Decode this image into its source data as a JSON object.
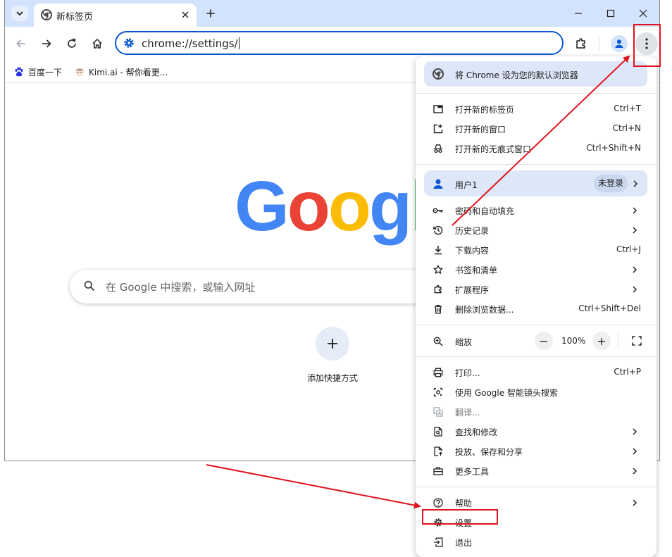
{
  "tab": {
    "title": "新标签页"
  },
  "omnibox": {
    "url": "chrome://settings/"
  },
  "bookmarks": [
    {
      "label": "百度一下"
    },
    {
      "label": "Kimi.ai - 帮你看更..."
    }
  ],
  "ntp": {
    "logo": "Google",
    "search_placeholder": "在 Google 中搜索，或输入网址",
    "shortcut_label": "添加快捷方式"
  },
  "menu": {
    "default_browser": "将 Chrome 设为您的默认浏览器",
    "group1": [
      {
        "label": "打开新的标签页",
        "shortcut": "Ctrl+T"
      },
      {
        "label": "打开新的窗口",
        "shortcut": "Ctrl+N"
      },
      {
        "label": "打开新的无痕式窗口",
        "shortcut": "Ctrl+Shift+N"
      }
    ],
    "profile": {
      "label": "用户1",
      "badge": "未登录"
    },
    "group2": [
      {
        "label": "密码和自动填充",
        "shortcut": ""
      },
      {
        "label": "历史记录",
        "shortcut": ""
      },
      {
        "label": "下载内容",
        "shortcut": "Ctrl+J"
      },
      {
        "label": "书签和清单",
        "shortcut": ""
      },
      {
        "label": "扩展程序",
        "shortcut": ""
      },
      {
        "label": "删除浏览数据...",
        "shortcut": "Ctrl+Shift+Del"
      }
    ],
    "zoom": {
      "label": "缩放",
      "minus": "−",
      "value": "100%",
      "plus": "+"
    },
    "group3": [
      {
        "label": "打印...",
        "shortcut": "Ctrl+P"
      },
      {
        "label": "使用 Google 智能镜头搜索",
        "shortcut": ""
      },
      {
        "label": "翻译...",
        "shortcut": ""
      },
      {
        "label": "查找和修改",
        "shortcut": ""
      },
      {
        "label": "投放、保存和分享",
        "shortcut": ""
      },
      {
        "label": "更多工具",
        "shortcut": ""
      }
    ],
    "group4": [
      {
        "label": "帮助"
      },
      {
        "label": "设置"
      },
      {
        "label": "退出"
      }
    ]
  },
  "colors": {
    "accent": "#0b57d0",
    "tabstrip": "#d3e3fd",
    "highlight": "#dde7f7",
    "annotation_red": "#e0141e",
    "google_blue": "#4285f4",
    "google_red": "#ea4335",
    "google_yellow": "#fbbc05",
    "google_green": "#34a853"
  },
  "icons": [
    "chevron-down-icon",
    "chrome-icon",
    "close-icon",
    "plus-icon",
    "minimize-icon",
    "maximize-icon",
    "back-icon",
    "forward-icon",
    "reload-icon",
    "home-icon",
    "settings-gear-icon",
    "extensions-icon",
    "profile-icon",
    "more-vert-icon",
    "baidu-icon",
    "kimi-icon",
    "search-icon"
  ]
}
